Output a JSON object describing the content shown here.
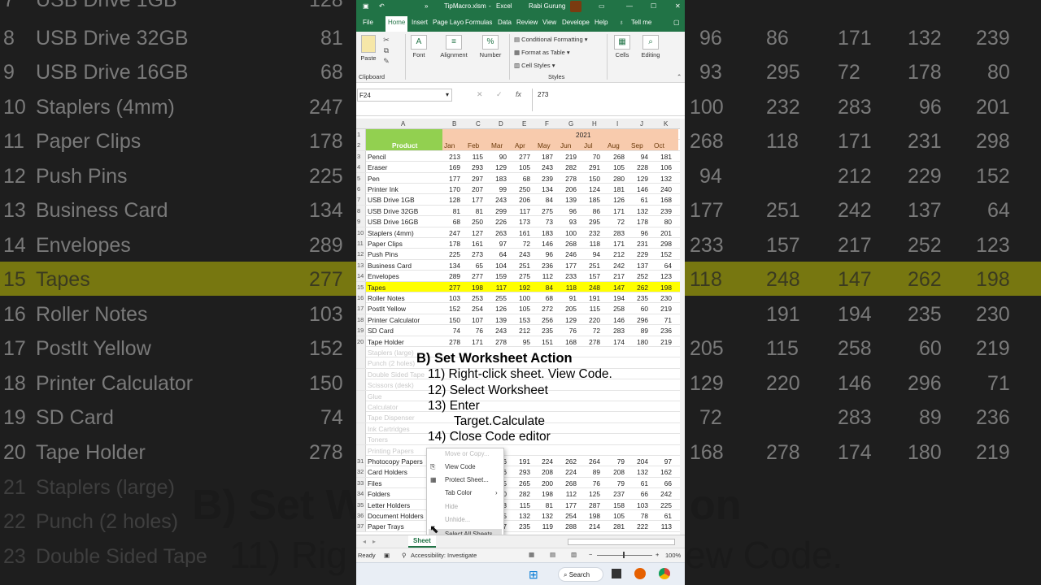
{
  "app": {
    "filename": "TipMacro.xlsm",
    "app_name": "Excel",
    "user": "Rabi Gurung"
  },
  "ribbon_tabs": [
    "File",
    "Home",
    "Insert",
    "Page Layo",
    "Formulas",
    "Data",
    "Review",
    "View",
    "Develope",
    "Help",
    "Tell me"
  ],
  "ribbon": {
    "paste": "Paste",
    "clipboard": "Clipboard",
    "font": "Font",
    "alignment": "Alignment",
    "number": "Number",
    "conditional_formatting": "Conditional Formatting",
    "format_as_table": "Format as Table",
    "cell_styles": "Cell Styles",
    "styles": "Styles",
    "cells": "Cells",
    "editing": "Editing"
  },
  "formula_bar": {
    "name_box": "F24",
    "fx": "fx",
    "value": "273"
  },
  "columns": [
    "A",
    "B",
    "C",
    "D",
    "E",
    "F",
    "G",
    "H",
    "I",
    "J",
    "K"
  ],
  "header": {
    "year": "2021",
    "product": "Product",
    "months": [
      "Jan",
      "Feb",
      "Mar",
      "Apr",
      "May",
      "Jun",
      "Jul",
      "Aug",
      "Sep",
      "Oct"
    ]
  },
  "rows": [
    {
      "n": "3",
      "name": "Pencil",
      "v": [
        "213",
        "115",
        "90",
        "277",
        "187",
        "219",
        "70",
        "268",
        "94",
        "181"
      ]
    },
    {
      "n": "4",
      "name": "Eraser",
      "v": [
        "169",
        "293",
        "129",
        "105",
        "243",
        "282",
        "291",
        "105",
        "228",
        "106"
      ]
    },
    {
      "n": "5",
      "name": "Pen",
      "v": [
        "177",
        "297",
        "183",
        "68",
        "239",
        "278",
        "150",
        "280",
        "129",
        "132"
      ]
    },
    {
      "n": "6",
      "name": "Printer Ink",
      "v": [
        "170",
        "207",
        "99",
        "250",
        "134",
        "206",
        "124",
        "181",
        "146",
        "240"
      ]
    },
    {
      "n": "7",
      "name": "USB Drive 1GB",
      "v": [
        "128",
        "177",
        "243",
        "206",
        "84",
        "139",
        "185",
        "126",
        "61",
        "168"
      ]
    },
    {
      "n": "8",
      "name": "USB Drive 32GB",
      "v": [
        "81",
        "81",
        "299",
        "117",
        "275",
        "96",
        "86",
        "171",
        "132",
        "239"
      ]
    },
    {
      "n": "9",
      "name": "USB Drive 16GB",
      "v": [
        "68",
        "250",
        "226",
        "173",
        "73",
        "93",
        "295",
        "72",
        "178",
        "80"
      ]
    },
    {
      "n": "10",
      "name": "Staplers (4mm)",
      "v": [
        "247",
        "127",
        "263",
        "161",
        "183",
        "100",
        "232",
        "283",
        "96",
        "201"
      ]
    },
    {
      "n": "11",
      "name": "Paper Clips",
      "v": [
        "178",
        "161",
        "97",
        "72",
        "146",
        "268",
        "118",
        "171",
        "231",
        "298"
      ]
    },
    {
      "n": "12",
      "name": "Push Pins",
      "v": [
        "225",
        "273",
        "64",
        "243",
        "96",
        "246",
        "94",
        "212",
        "229",
        "152"
      ]
    },
    {
      "n": "13",
      "name": "Business Card",
      "v": [
        "134",
        "65",
        "104",
        "251",
        "236",
        "177",
        "251",
        "242",
        "137",
        "64"
      ]
    },
    {
      "n": "14",
      "name": "Envelopes",
      "v": [
        "289",
        "277",
        "159",
        "275",
        "112",
        "233",
        "157",
        "217",
        "252",
        "123"
      ]
    },
    {
      "n": "15",
      "name": "Tapes",
      "v": [
        "277",
        "198",
        "117",
        "192",
        "84",
        "118",
        "248",
        "147",
        "262",
        "198"
      ]
    },
    {
      "n": "16",
      "name": "Roller Notes",
      "v": [
        "103",
        "253",
        "255",
        "100",
        "68",
        "91",
        "191",
        "194",
        "235",
        "230"
      ]
    },
    {
      "n": "17",
      "name": "PostIt Yellow",
      "v": [
        "152",
        "254",
        "126",
        "105",
        "272",
        "205",
        "115",
        "258",
        "60",
        "219"
      ]
    },
    {
      "n": "18",
      "name": "Printer Calculator",
      "v": [
        "150",
        "107",
        "139",
        "153",
        "256",
        "129",
        "220",
        "146",
        "296",
        "71"
      ]
    },
    {
      "n": "19",
      "name": "SD Card",
      "v": [
        "74",
        "76",
        "243",
        "212",
        "235",
        "76",
        "72",
        "283",
        "89",
        "236"
      ]
    },
    {
      "n": "20",
      "name": "Tape Holder",
      "v": [
        "278",
        "171",
        "278",
        "95",
        "151",
        "168",
        "278",
        "174",
        "180",
        "219"
      ]
    }
  ],
  "faded_rows": [
    "Staplers (large)",
    "Punch (2 holes)",
    "Double Sided Tape",
    "Scissors (desk)",
    "Glue",
    "Calculator",
    "Tape Dispenser",
    "Ink Cartridges",
    "Toners",
    "Printing Papers"
  ],
  "lower_rows": [
    {
      "n": "31",
      "name": "Photocopy Papers",
      "v": [
        "66",
        "191",
        "224",
        "262",
        "264",
        "79",
        "204",
        "97"
      ]
    },
    {
      "n": "32",
      "name": "Card Holders",
      "v": [
        "66",
        "293",
        "208",
        "224",
        "89",
        "208",
        "132",
        "162"
      ]
    },
    {
      "n": "33",
      "name": "Files",
      "v": [
        "65",
        "265",
        "200",
        "268",
        "76",
        "79",
        "61",
        "66"
      ]
    },
    {
      "n": "34",
      "name": "Folders",
      "v": [
        "80",
        "282",
        "198",
        "112",
        "125",
        "237",
        "66",
        "242"
      ]
    },
    {
      "n": "35",
      "name": "Letter Holders",
      "v": [
        "48",
        "115",
        "81",
        "177",
        "287",
        "158",
        "103",
        "225"
      ]
    },
    {
      "n": "36",
      "name": "Document Holders",
      "v": [
        "75",
        "132",
        "132",
        "254",
        "198",
        "105",
        "78",
        "61"
      ]
    },
    {
      "n": "37",
      "name": "Paper Trays",
      "v": [
        "57",
        "235",
        "119",
        "288",
        "214",
        "281",
        "222",
        "113"
      ]
    }
  ],
  "context_menu": {
    "move_copy": "Move or Copy...",
    "view_code": "View Code",
    "protect_sheet": "Protect Sheet...",
    "tab_color": "Tab Color",
    "hide": "Hide",
    "unhide": "Unhide...",
    "select_all": "Select All Sheets"
  },
  "overlay": {
    "title": "B) Set Worksheet Action",
    "step11": "11) Right-click sheet. View Code.",
    "step12": "12) Select Worksheet",
    "step13": "13) Enter",
    "step13b": "Target.Calculate",
    "step14": "14) Close Code editor"
  },
  "sheet_tab": "Sheet",
  "status": {
    "ready": "Ready",
    "accessibility": "Accessibility: Investigate",
    "zoom": "100%"
  },
  "taskbar": {
    "search": "Search"
  },
  "background": {
    "caption_big": "B) Set W",
    "caption_big_right": "on",
    "caption_line2_left": "11) Rig",
    "caption_line2_right": "ew Code."
  },
  "colors": {
    "excel_green": "#217346",
    "highlight": "#ffff00",
    "header_green": "#92d050",
    "header_salmon": "#f8cbad"
  }
}
